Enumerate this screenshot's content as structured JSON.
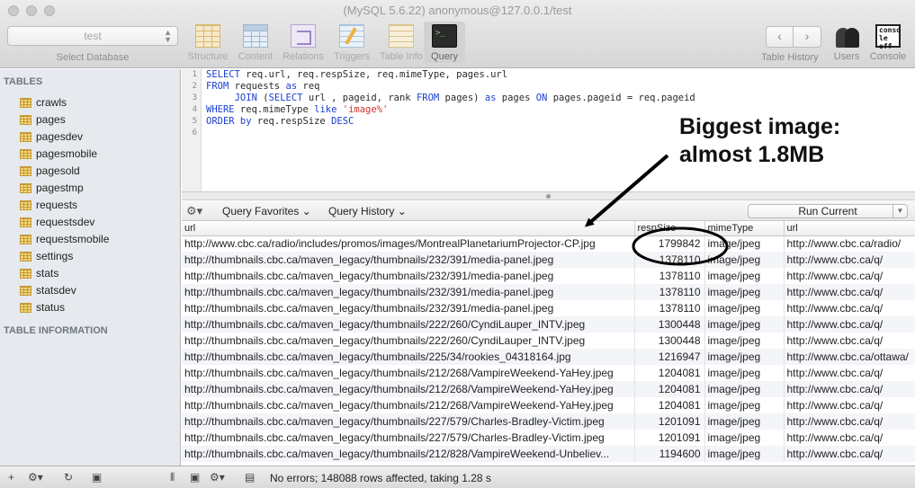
{
  "window": {
    "title": "(MySQL 5.6.22) anonymous@127.0.0.1/test"
  },
  "toolbar": {
    "database_value": "test",
    "database_label": "Select Database",
    "tools": [
      {
        "label": "Structure",
        "icon": "structure-icon"
      },
      {
        "label": "Content",
        "icon": "content-grid-icon"
      },
      {
        "label": "Relations",
        "icon": "relations-icon"
      },
      {
        "label": "Triggers",
        "icon": "triggers-icon"
      },
      {
        "label": "Table Info",
        "icon": "table-info-icon"
      },
      {
        "label": "Query",
        "icon": "query-terminal-icon"
      }
    ],
    "history_label": "Table History",
    "users_label": "Users",
    "console_label": "Console",
    "console_icon_text": "conso le off"
  },
  "sidebar": {
    "tables_heading": "TABLES",
    "tables": [
      "crawls",
      "pages",
      "pagesdev",
      "pagesmobile",
      "pagesold",
      "pagestmp",
      "requests",
      "requestsdev",
      "requestsmobile",
      "settings",
      "stats",
      "statsdev",
      "status"
    ],
    "info_heading": "TABLE INFORMATION"
  },
  "editor": {
    "line_numbers": [
      "1",
      "2",
      "3",
      "4",
      "5",
      "6"
    ],
    "lines": [
      {
        "kw1": "SELECT",
        "t1": " req.url, req.respSize, req.mimeType, pages.url"
      },
      {
        "kw1": "FROM",
        "t1": " requests ",
        "kw2": "as",
        "t2": " req"
      },
      {
        "pre": "     ",
        "kw1": "JOIN",
        "t1": " (",
        "kw2": "SELECT",
        "t2": " url , pageid, rank ",
        "kw3": "FROM",
        "t3": " pages) ",
        "kw4": "as",
        "t4": " pages ",
        "kw5": "ON",
        "t5": " pages.pageid = req.pageid"
      },
      {
        "kw1": "WHERE",
        "t1": " req.mimeType ",
        "kw2": "like",
        "str": " 'image%'"
      },
      {
        "kw1": "ORDER by",
        "t1": " req.respSize ",
        "kw2": "DESC"
      },
      {
        "t1": ""
      }
    ]
  },
  "results_toolbar": {
    "favorites": "Query Favorites",
    "history": "Query History",
    "run": "Run Current"
  },
  "results": {
    "columns": [
      "url",
      "respSize",
      "mimeType",
      "url"
    ],
    "rows": [
      [
        "http://www.cbc.ca/radio/includes/promos/images/MontrealPlanetariumProjector-CP.jpg",
        "1799842",
        "image/jpeg",
        "http://www.cbc.ca/radio/"
      ],
      [
        "http://thumbnails.cbc.ca/maven_legacy/thumbnails/232/391/media-panel.jpeg",
        "1378110",
        "image/jpeg",
        "http://www.cbc.ca/q/"
      ],
      [
        "http://thumbnails.cbc.ca/maven_legacy/thumbnails/232/391/media-panel.jpeg",
        "1378110",
        "image/jpeg",
        "http://www.cbc.ca/q/"
      ],
      [
        "http://thumbnails.cbc.ca/maven_legacy/thumbnails/232/391/media-panel.jpeg",
        "1378110",
        "image/jpeg",
        "http://www.cbc.ca/q/"
      ],
      [
        "http://thumbnails.cbc.ca/maven_legacy/thumbnails/232/391/media-panel.jpeg",
        "1378110",
        "image/jpeg",
        "http://www.cbc.ca/q/"
      ],
      [
        "http://thumbnails.cbc.ca/maven_legacy/thumbnails/222/260/CyndiLauper_INTV.jpeg",
        "1300448",
        "image/jpeg",
        "http://www.cbc.ca/q/"
      ],
      [
        "http://thumbnails.cbc.ca/maven_legacy/thumbnails/222/260/CyndiLauper_INTV.jpeg",
        "1300448",
        "image/jpeg",
        "http://www.cbc.ca/q/"
      ],
      [
        "http://thumbnails.cbc.ca/maven_legacy/thumbnails/225/34/rookies_04318164.jpg",
        "1216947",
        "image/jpeg",
        "http://www.cbc.ca/ottawa/"
      ],
      [
        "http://thumbnails.cbc.ca/maven_legacy/thumbnails/212/268/VampireWeekend-YaHey.jpeg",
        "1204081",
        "image/jpeg",
        "http://www.cbc.ca/q/"
      ],
      [
        "http://thumbnails.cbc.ca/maven_legacy/thumbnails/212/268/VampireWeekend-YaHey.jpeg",
        "1204081",
        "image/jpeg",
        "http://www.cbc.ca/q/"
      ],
      [
        "http://thumbnails.cbc.ca/maven_legacy/thumbnails/212/268/VampireWeekend-YaHey.jpeg",
        "1204081",
        "image/jpeg",
        "http://www.cbc.ca/q/"
      ],
      [
        "http://thumbnails.cbc.ca/maven_legacy/thumbnails/227/579/Charles-Bradley-Victim.jpeg",
        "1201091",
        "image/jpeg",
        "http://www.cbc.ca/q/"
      ],
      [
        "http://thumbnails.cbc.ca/maven_legacy/thumbnails/227/579/Charles-Bradley-Victim.jpeg",
        "1201091",
        "image/jpeg",
        "http://www.cbc.ca/q/"
      ],
      [
        "http://thumbnails.cbc.ca/maven_legacy/thumbnails/212/828/VampireWeekend-Unbeliev...",
        "1194600",
        "image/jpeg",
        "http://www.cbc.ca/q/"
      ]
    ]
  },
  "status": {
    "message": "No errors; 148088 rows affected, taking 1.28 s"
  },
  "annotation": {
    "line1": "Biggest image:",
    "line2": "almost 1.8MB"
  },
  "colors": {
    "keyword": "#1a3fd0",
    "string": "#d13030",
    "sidebar_bg": "#e6e9ee"
  }
}
